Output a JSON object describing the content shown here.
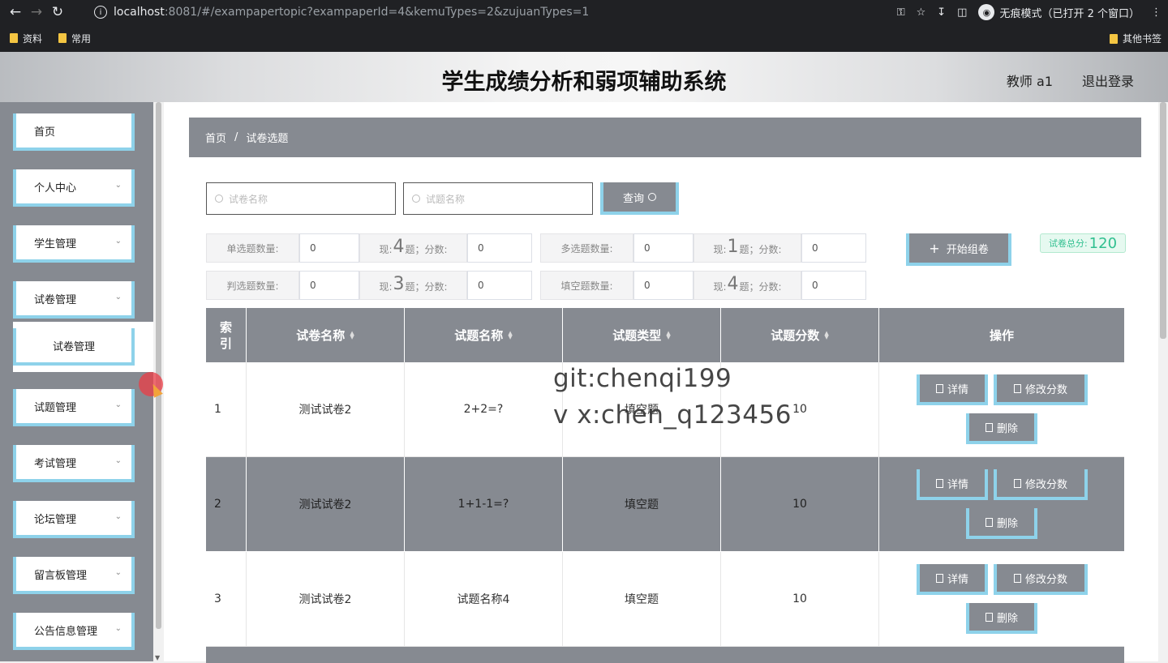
{
  "browser": {
    "url_host": "localhost",
    "url_rest": ":8081/#/exampapertopic?exampaperId=4&kemuTypes=2&zujuanTypes=1",
    "incognito_label": "无痕模式（已打开 2 个窗口）",
    "bookmarks": [
      "资料",
      "常用"
    ],
    "other_bookmarks": "其他书签"
  },
  "header": {
    "title": "学生成绩分析和弱项辅助系统",
    "user": "教师 a1",
    "logout": "退出登录"
  },
  "sidebar": {
    "items": [
      {
        "label": "首页",
        "has_children": false
      },
      {
        "label": "个人中心",
        "has_children": true
      },
      {
        "label": "学生管理",
        "has_children": true
      },
      {
        "label": "试卷管理",
        "has_children": true
      },
      {
        "label": "试题管理",
        "has_children": true
      },
      {
        "label": "考试管理",
        "has_children": true
      },
      {
        "label": "论坛管理",
        "has_children": true
      },
      {
        "label": "留言板管理",
        "has_children": true
      },
      {
        "label": "公告信息管理",
        "has_children": true
      }
    ],
    "submenu_label": "试卷管理"
  },
  "breadcrumb": {
    "home": "首页",
    "sep": "/",
    "current": "试卷选题"
  },
  "search": {
    "paper_placeholder": "试卷名称",
    "topic_placeholder": "试题名称",
    "query_button": "查询"
  },
  "stats": {
    "single": {
      "label": "单选题数量:",
      "value": "0",
      "now_prefix": "现:",
      "now_count": "4",
      "now_suffix": "题；分数:",
      "score": "0"
    },
    "multi": {
      "label": "多选题数量:",
      "value": "0",
      "now_prefix": "现:",
      "now_count": "1",
      "now_suffix": "题；分数:",
      "score": "0"
    },
    "judge": {
      "label": "判选题数量:",
      "value": "0",
      "now_prefix": "现:",
      "now_count": "3",
      "now_suffix": "题；分数:",
      "score": "0"
    },
    "fill": {
      "label": "填空题数量:",
      "value": "0",
      "now_prefix": "现:",
      "now_count": "4",
      "now_suffix": "题；分数:",
      "score": "0"
    }
  },
  "compose_button": "开始组卷",
  "total": {
    "label": "试卷总分:",
    "value": "120"
  },
  "table": {
    "headers": [
      "索引",
      "试卷名称",
      "试题名称",
      "试题类型",
      "试题分数",
      "操作"
    ],
    "rows": [
      {
        "index": "1",
        "paper": "测试试卷2",
        "topic": "2+2=?",
        "type": "填空题",
        "score": "10"
      },
      {
        "index": "2",
        "paper": "测试试卷2",
        "topic": "1+1-1=?",
        "type": "填空题",
        "score": "10"
      },
      {
        "index": "3",
        "paper": "测试试卷2",
        "topic": "试题名称4",
        "type": "填空题",
        "score": "10"
      }
    ],
    "actions": {
      "detail": "详情",
      "edit_score": "修改分数",
      "delete": "删除"
    }
  },
  "watermark": {
    "line1": "git:chenqi199",
    "line2": "v x:chen_q123456"
  },
  "colors": {
    "accent_border": "#8ed2ea",
    "gray_fill": "#868a91",
    "total_green": "#2fbf8f"
  }
}
